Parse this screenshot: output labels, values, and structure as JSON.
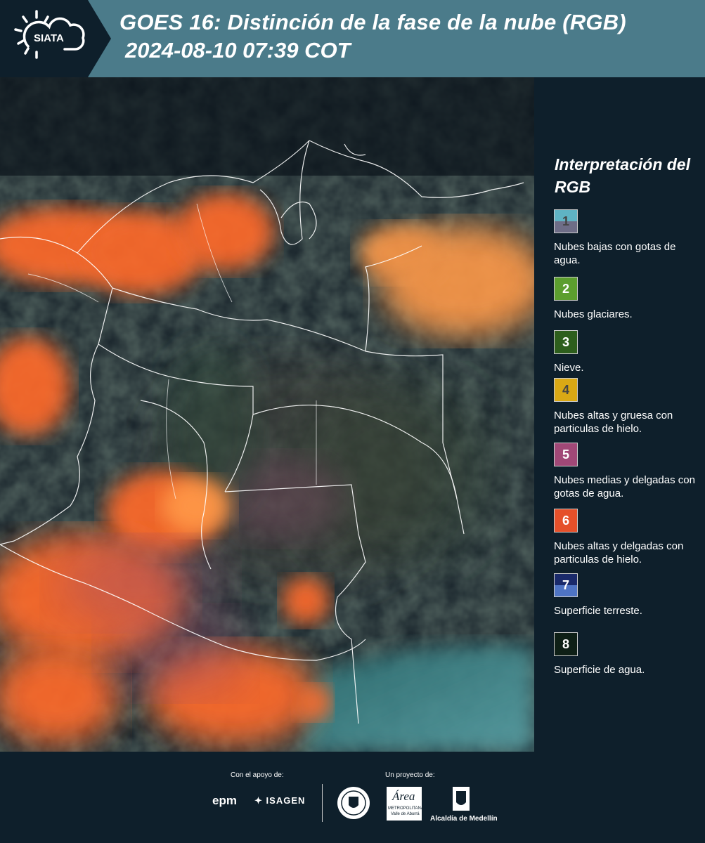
{
  "header": {
    "logo_text": "SIATA",
    "title_line1": "GOES 16: Distinción de la fase de la nube (RGB)",
    "title_line2": "2024-08-10 07:39 COT"
  },
  "legend": {
    "title": "Interpretación del RGB",
    "items": [
      {
        "number": "1",
        "label": "Nubes bajas con gotas de agua.",
        "color_top": "#5fb3c4",
        "color_bottom": "#6e6d87",
        "num_color": "#444444"
      },
      {
        "number": "2",
        "label": "Nubes glaciares.",
        "color_top": "#5c9e2e",
        "color_bottom": "#5c9e2e",
        "num_color": "#ffffff"
      },
      {
        "number": "3",
        "label": "Nieve.",
        "color_top": "#2d5e1c",
        "color_bottom": "#2d5e1c",
        "num_color": "#ffffff"
      },
      {
        "number": "4",
        "label": "Nubes altas y gruesa con particulas de hielo.",
        "color_top": "#d9a815",
        "color_bottom": "#d9a815",
        "num_color": "#444444"
      },
      {
        "number": "5",
        "label": "Nubes medias y delgadas con gotas de agua.",
        "color_top": "#a14877",
        "color_bottom": "#a14877",
        "num_color": "#ffffff"
      },
      {
        "number": "6",
        "label": "Nubes altas y delgadas con particulas de hielo.",
        "color_top": "#e5502a",
        "color_bottom": "#e5502a",
        "num_color": "#ffffff"
      },
      {
        "number": "7",
        "label": "Superficie terreste.",
        "color_top": "#1a2a6b",
        "color_bottom": "#4f74c4",
        "num_color": "#ffffff"
      },
      {
        "number": "8",
        "label": "Superficie de agua.",
        "color_top": "#0e1f16",
        "color_bottom": "#0e1f16",
        "num_color": "#ffffff"
      }
    ]
  },
  "footer": {
    "support_label": "Con el apoyo de:",
    "project_label": "Un proyecto de:",
    "epm": "epm",
    "isagen": "ISAGEN",
    "area_name": "Área",
    "area_sub1": "METROPOLITANA",
    "area_sub2": "Valle de Aburrá",
    "alcaldia": "Alcaldía de Medellín"
  }
}
